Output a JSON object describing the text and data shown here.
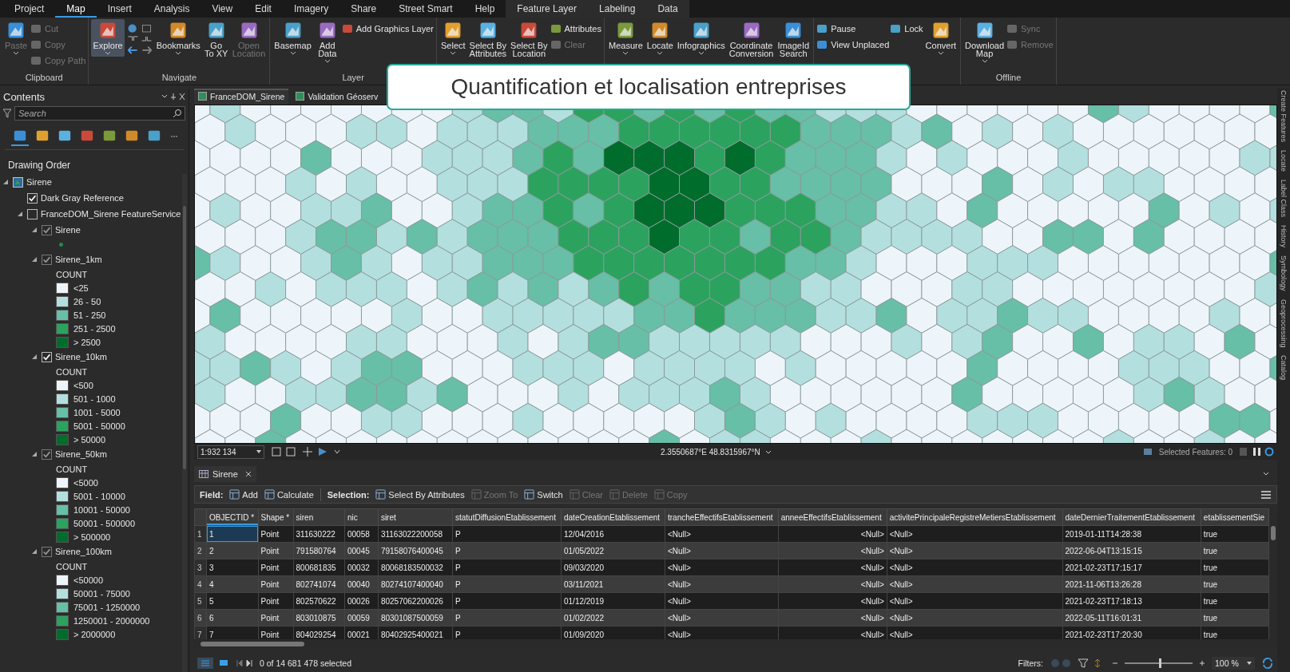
{
  "ribbon_tabs": [
    {
      "label": "Project",
      "selected": false,
      "kind": "standard"
    },
    {
      "label": "Map",
      "selected": true,
      "kind": "standard"
    },
    {
      "label": "Insert",
      "selected": false,
      "kind": "standard"
    },
    {
      "label": "Analysis",
      "selected": false,
      "kind": "standard"
    },
    {
      "label": "View",
      "selected": false,
      "kind": "standard"
    },
    {
      "label": "Edit",
      "selected": false,
      "kind": "standard"
    },
    {
      "label": "Imagery",
      "selected": false,
      "kind": "standard"
    },
    {
      "label": "Share",
      "selected": false,
      "kind": "standard"
    },
    {
      "label": "Street Smart",
      "selected": false,
      "kind": "standard"
    },
    {
      "label": "Help",
      "selected": false,
      "kind": "standard"
    },
    {
      "label": "Feature Layer",
      "selected": false,
      "kind": "contextual"
    },
    {
      "label": "Labeling",
      "selected": false,
      "kind": "contextual"
    },
    {
      "label": "Data",
      "selected": false,
      "kind": "contextual"
    }
  ],
  "ribbon": {
    "groups": [
      {
        "label": "Clipboard",
        "items": [
          {
            "kind": "large",
            "lines": [
              "Paste"
            ],
            "dropdown": true,
            "selected": false,
            "disabled": true
          },
          {
            "kind": "stack",
            "tools": [
              {
                "label": "Cut",
                "disabled": true
              },
              {
                "label": "Copy",
                "disabled": true
              },
              {
                "label": "Copy Path",
                "disabled": true
              }
            ]
          }
        ]
      },
      {
        "label": "Navigate",
        "items": [
          {
            "kind": "large",
            "lines": [
              "Explore"
            ],
            "dropdown": true,
            "selected": true,
            "disabled": false
          },
          {
            "kind": "grid"
          },
          {
            "kind": "large",
            "lines": [
              "Bookmarks"
            ],
            "dropdown": true,
            "selected": false,
            "disabled": false
          },
          {
            "kind": "large",
            "lines": [
              "Go",
              "To XY"
            ],
            "dropdown": false,
            "selected": false,
            "disabled": false
          },
          {
            "kind": "large",
            "lines": [
              "Open",
              "Location"
            ],
            "dropdown": false,
            "selected": false,
            "disabled": true
          }
        ]
      },
      {
        "label": "Layer",
        "items": [
          {
            "kind": "large",
            "lines": [
              "Basemap"
            ],
            "dropdown": true,
            "selected": false,
            "disabled": false
          },
          {
            "kind": "large",
            "lines": [
              "Add",
              "Data"
            ],
            "dropdown": true,
            "selected": false,
            "disabled": false
          },
          {
            "kind": "stack",
            "tools": [
              {
                "label": "Add Graphics Layer",
                "disabled": false
              }
            ]
          }
        ]
      },
      {
        "items": [
          {
            "kind": "large",
            "lines": [
              "Select"
            ],
            "dropdown": true,
            "selected": false,
            "disabled": false
          },
          {
            "kind": "large",
            "lines": [
              "Select By",
              "Attributes"
            ],
            "dropdown": false,
            "selected": false,
            "disabled": false
          },
          {
            "kind": "large",
            "lines": [
              "Select By",
              "Location"
            ],
            "dropdown": false,
            "selected": false,
            "disabled": false
          },
          {
            "kind": "stack",
            "tools": [
              {
                "label": "Attributes",
                "disabled": false
              },
              {
                "label": "Clear",
                "disabled": true
              }
            ]
          }
        ]
      },
      {
        "items": [
          {
            "kind": "large",
            "lines": [
              "Measure"
            ],
            "dropdown": true,
            "selected": false,
            "disabled": false
          },
          {
            "kind": "large",
            "lines": [
              "Locate"
            ],
            "dropdown": true,
            "selected": false,
            "disabled": false
          },
          {
            "kind": "large",
            "lines": [
              "Infographics"
            ],
            "dropdown": true,
            "selected": false,
            "disabled": false
          },
          {
            "kind": "large",
            "lines": [
              "Coordinate",
              "Conversion"
            ],
            "dropdown": false,
            "selected": false,
            "disabled": false
          },
          {
            "kind": "large",
            "lines": [
              "ImageId",
              "Search"
            ],
            "dropdown": false,
            "selected": false,
            "disabled": false
          }
        ]
      },
      {
        "items": [
          {
            "kind": "stack",
            "tools": [
              {
                "label": "Pause",
                "disabled": false
              },
              {
                "label": "View Unplaced",
                "disabled": false
              }
            ]
          },
          {
            "kind": "stack",
            "tools": [
              {
                "label": "Lock",
                "disabled": false
              }
            ]
          },
          {
            "kind": "large",
            "lines": [
              "Convert"
            ],
            "dropdown": true,
            "selected": false,
            "disabled": false
          }
        ]
      },
      {
        "label": "Offline",
        "items": [
          {
            "kind": "large",
            "lines": [
              "Download",
              "Map"
            ],
            "dropdown": true,
            "selected": false,
            "disabled": false
          },
          {
            "kind": "stack",
            "tools": [
              {
                "label": "Sync",
                "disabled": true
              },
              {
                "label": "Remove",
                "disabled": true
              }
            ]
          }
        ]
      }
    ]
  },
  "overlay_title": "Quantification et localisation entreprises",
  "contents": {
    "title": "Contents",
    "search": {
      "placeholder": "Search"
    },
    "view_tabs": [
      {
        "selected": true
      },
      {
        "selected": false
      },
      {
        "selected": false
      },
      {
        "selected": false
      },
      {
        "selected": false
      },
      {
        "selected": false
      },
      {
        "selected": false
      }
    ],
    "heading": "Drawing Order",
    "tree": [
      {
        "label": "Sirene",
        "kind": "map",
        "expanded": true,
        "children": [
          {
            "label": "Dark Gray Reference",
            "kind": "layer",
            "checked": true,
            "dimmed": false
          },
          {
            "label": "FranceDOM_Sirene FeatureService",
            "kind": "layer",
            "checked": false,
            "expanded": true,
            "children": [
              {
                "label": "Sirene",
                "kind": "layer",
                "checked": true,
                "dimmed": true,
                "expanded": true,
                "legend": {
                  "kind": "point",
                  "classes": [
                    {
                      "color": "#1f8a4c"
                    }
                  ]
                }
              },
              {
                "label": "Sirene_1km",
                "kind": "layer",
                "checked": true,
                "dimmed": true,
                "expanded": true,
                "legend": {
                  "kind": "classes",
                  "heading": "COUNT",
                  "classes": [
                    {
                      "label": "<25",
                      "color": "#eef5fa"
                    },
                    {
                      "label": "26 - 50",
                      "color": "#b3dfdf"
                    },
                    {
                      "label": "51 - 250",
                      "color": "#66bfa6"
                    },
                    {
                      "label": "251 - 2500",
                      "color": "#2ca25f"
                    },
                    {
                      "label": "> 2500",
                      "color": "#006d2c"
                    }
                  ]
                }
              },
              {
                "label": "Sirene_10km",
                "kind": "layer",
                "checked": true,
                "dimmed": false,
                "expanded": true,
                "legend": {
                  "kind": "classes",
                  "heading": "COUNT",
                  "classes": [
                    {
                      "label": "<500",
                      "color": "#eef5fa"
                    },
                    {
                      "label": "501 - 1000",
                      "color": "#b3dfdf"
                    },
                    {
                      "label": "1001 - 5000",
                      "color": "#66bfa6"
                    },
                    {
                      "label": "5001 - 50000",
                      "color": "#2ca25f"
                    },
                    {
                      "label": "> 50000",
                      "color": "#006d2c"
                    }
                  ]
                }
              },
              {
                "label": "Sirene_50km",
                "kind": "layer",
                "checked": true,
                "dimmed": true,
                "expanded": true,
                "legend": {
                  "kind": "classes",
                  "heading": "COUNT",
                  "classes": [
                    {
                      "label": "<5000",
                      "color": "#eef5fa"
                    },
                    {
                      "label": "5001 - 10000",
                      "color": "#b3dfdf"
                    },
                    {
                      "label": "10001 - 50000",
                      "color": "#66bfa6"
                    },
                    {
                      "label": "50001 - 500000",
                      "color": "#2ca25f"
                    },
                    {
                      "label": "> 500000",
                      "color": "#006d2c"
                    }
                  ]
                }
              },
              {
                "label": "Sirene_100km",
                "kind": "layer",
                "checked": true,
                "dimmed": true,
                "expanded": true,
                "legend": {
                  "kind": "classes",
                  "heading": "COUNT",
                  "classes": [
                    {
                      "label": "<50000",
                      "color": "#eef5fa"
                    },
                    {
                      "label": "50001 - 75000",
                      "color": "#b3dfdf"
                    },
                    {
                      "label": "75001 - 1250000",
                      "color": "#66bfa6"
                    },
                    {
                      "label": "1250001 - 2000000",
                      "color": "#2ca25f"
                    },
                    {
                      "label": "> 2000000",
                      "color": "#006d2c"
                    }
                  ]
                }
              }
            ]
          }
        ]
      }
    ]
  },
  "map_tabs": [
    {
      "label": "FranceDOM_Sirene",
      "selected": true
    },
    {
      "label": "Validation Géoserv",
      "selected": false
    }
  ],
  "side_tabs": [
    "Create Features",
    "Locate",
    "Label Class",
    "History",
    "Symbology",
    "Geoprocessing",
    "Catalog"
  ],
  "map_status": {
    "scale": "1:932 134",
    "coordinates": "2.3550687°E 48.8315967°N",
    "selected_features": "Selected Features: 0"
  },
  "table": {
    "tab": "Sirene",
    "toolbar": [
      {
        "kind": "heading",
        "label": "Field:"
      },
      {
        "kind": "tool",
        "label": "Add",
        "disabled": false
      },
      {
        "kind": "tool",
        "label": "Calculate",
        "disabled": false
      },
      {
        "kind": "separator"
      },
      {
        "kind": "heading",
        "label": "Selection:"
      },
      {
        "kind": "tool",
        "label": "Select By Attributes",
        "disabled": false
      },
      {
        "kind": "tool",
        "label": "Zoom To",
        "disabled": true
      },
      {
        "kind": "tool",
        "label": "Switch",
        "disabled": false
      },
      {
        "kind": "tool",
        "label": "Clear",
        "disabled": true
      },
      {
        "kind": "tool",
        "label": "Delete",
        "disabled": true
      },
      {
        "kind": "tool",
        "label": "Copy",
        "disabled": true
      }
    ],
    "columns": [
      {
        "label": "OBJECTID *",
        "kind": "text"
      },
      {
        "label": "Shape *",
        "kind": "text"
      },
      {
        "label": "siren",
        "kind": "text"
      },
      {
        "label": "nic",
        "kind": "text"
      },
      {
        "label": "siret",
        "kind": "text"
      },
      {
        "label": "statutDiffusionEtablissement",
        "kind": "text"
      },
      {
        "label": "dateCreationEtablissement",
        "kind": "text"
      },
      {
        "label": "trancheEffectifsEtablissement",
        "kind": "text"
      },
      {
        "label": "anneeEffectifsEtablissement",
        "kind": "numeric"
      },
      {
        "label": "activitePrincipaleRegistreMetiersEtablissement",
        "kind": "text"
      },
      {
        "label": "dateDernierTraitementEtablissement",
        "kind": "text"
      },
      {
        "label": "etablissementSie",
        "kind": "text"
      }
    ],
    "rows": [
      {
        "number": "1",
        "current": true,
        "cells": [
          "1",
          "Point",
          "311630222",
          "00058",
          "31163022200058",
          "P",
          "12/04/2016",
          "<Null>",
          "<Null>",
          "<Null>",
          "2019-01-11T14:28:38",
          "true"
        ]
      },
      {
        "number": "2",
        "current": false,
        "cells": [
          "2",
          "Point",
          "791580764",
          "00045",
          "79158076400045",
          "P",
          "01/05/2022",
          "<Null>",
          "<Null>",
          "<Null>",
          "2022-06-04T13:15:15",
          "true"
        ]
      },
      {
        "number": "3",
        "current": false,
        "cells": [
          "3",
          "Point",
          "800681835",
          "00032",
          "80068183500032",
          "P",
          "09/03/2020",
          "<Null>",
          "<Null>",
          "<Null>",
          "2021-02-23T17:15:17",
          "true"
        ]
      },
      {
        "number": "4",
        "current": false,
        "cells": [
          "4",
          "Point",
          "802741074",
          "00040",
          "80274107400040",
          "P",
          "03/11/2021",
          "<Null>",
          "<Null>",
          "<Null>",
          "2021-11-06T13:26:28",
          "true"
        ]
      },
      {
        "number": "5",
        "current": false,
        "cells": [
          "5",
          "Point",
          "802570622",
          "00026",
          "80257062200026",
          "P",
          "01/12/2019",
          "<Null>",
          "<Null>",
          "<Null>",
          "2021-02-23T17:18:13",
          "true"
        ]
      },
      {
        "number": "6",
        "current": false,
        "cells": [
          "6",
          "Point",
          "803010875",
          "00059",
          "80301087500059",
          "P",
          "01/02/2022",
          "<Null>",
          "<Null>",
          "<Null>",
          "2022-05-11T16:01:31",
          "true"
        ]
      },
      {
        "number": "7",
        "current": false,
        "cells": [
          "7",
          "Point",
          "804029254",
          "00021",
          "80402925400021",
          "P",
          "01/09/2020",
          "<Null>",
          "<Null>",
          "<Null>",
          "2021-02-23T17:20:30",
          "true"
        ]
      }
    ],
    "status": "0 of 14 681 478 selected",
    "filters": "Filters:",
    "zoom": {
      "level": 0.5,
      "reading": "100 %"
    }
  }
}
